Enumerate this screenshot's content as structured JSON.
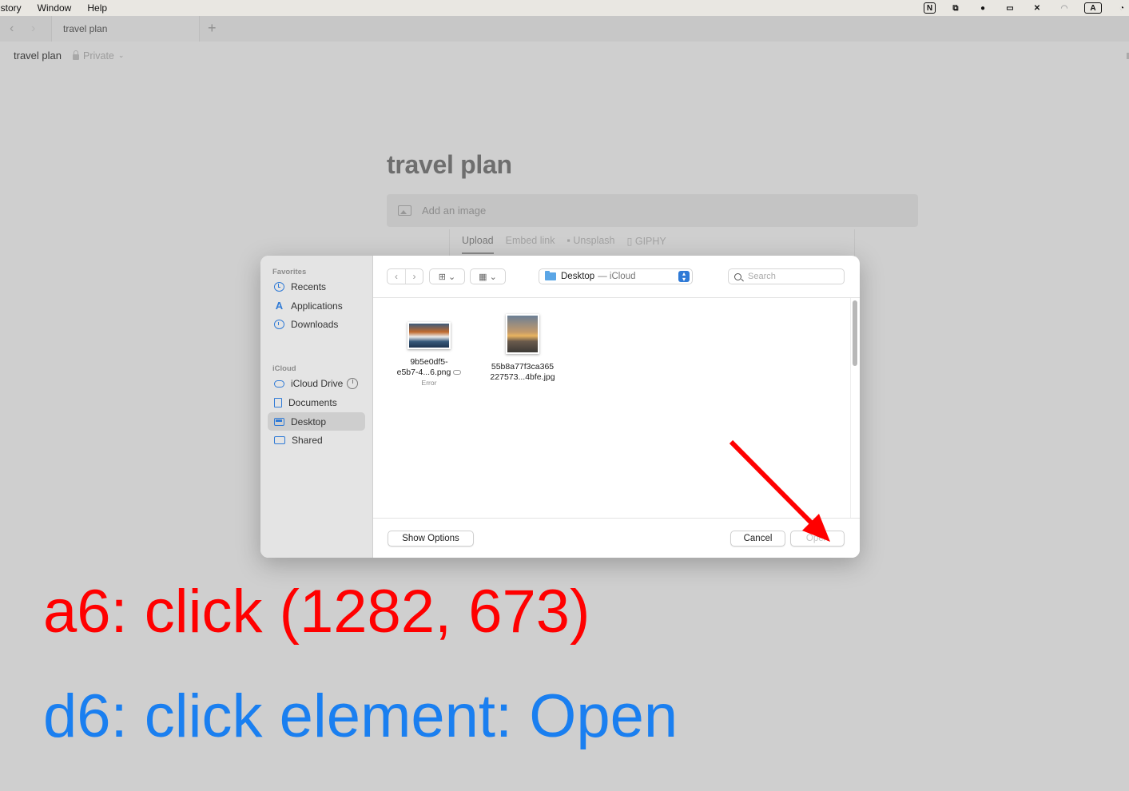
{
  "menubar": {
    "items": [
      "istory",
      "Window",
      "Help"
    ],
    "status_icons": [
      "N",
      "A"
    ]
  },
  "browser": {
    "tab_title": "travel plan"
  },
  "breadcrumb": {
    "title": "travel plan",
    "privacy": "Private"
  },
  "page": {
    "title": "travel plan",
    "add_image": "Add an image",
    "upload_tabs": [
      "Upload",
      "Embed link",
      "Unsplash",
      "GIPHY"
    ]
  },
  "dialog": {
    "sidebar": {
      "favorites_heading": "Favorites",
      "favorites": [
        "Recents",
        "Applications",
        "Downloads"
      ],
      "icloud_heading": "iCloud",
      "icloud": [
        "iCloud Drive",
        "Documents",
        "Desktop",
        "Shared"
      ],
      "selected": "Desktop"
    },
    "location": {
      "folder": "Desktop",
      "sub": "— iCloud"
    },
    "search_placeholder": "Search",
    "files": [
      {
        "line1": "9b5e0df5-",
        "line2": "e5b7-4...6.png",
        "status": "Error"
      },
      {
        "line1": "55b8a77f3ca365",
        "line2": "227573...4bfe.jpg",
        "status": ""
      }
    ],
    "buttons": {
      "show_options": "Show Options",
      "cancel": "Cancel",
      "open": "Open"
    }
  },
  "annotations": {
    "action": "a6: click (1282, 673)",
    "description": "d6: click element: Open"
  },
  "colors": {
    "action_text": "#ff0000",
    "description_text": "#1a7ff0",
    "accent": "#2f7ad6"
  }
}
